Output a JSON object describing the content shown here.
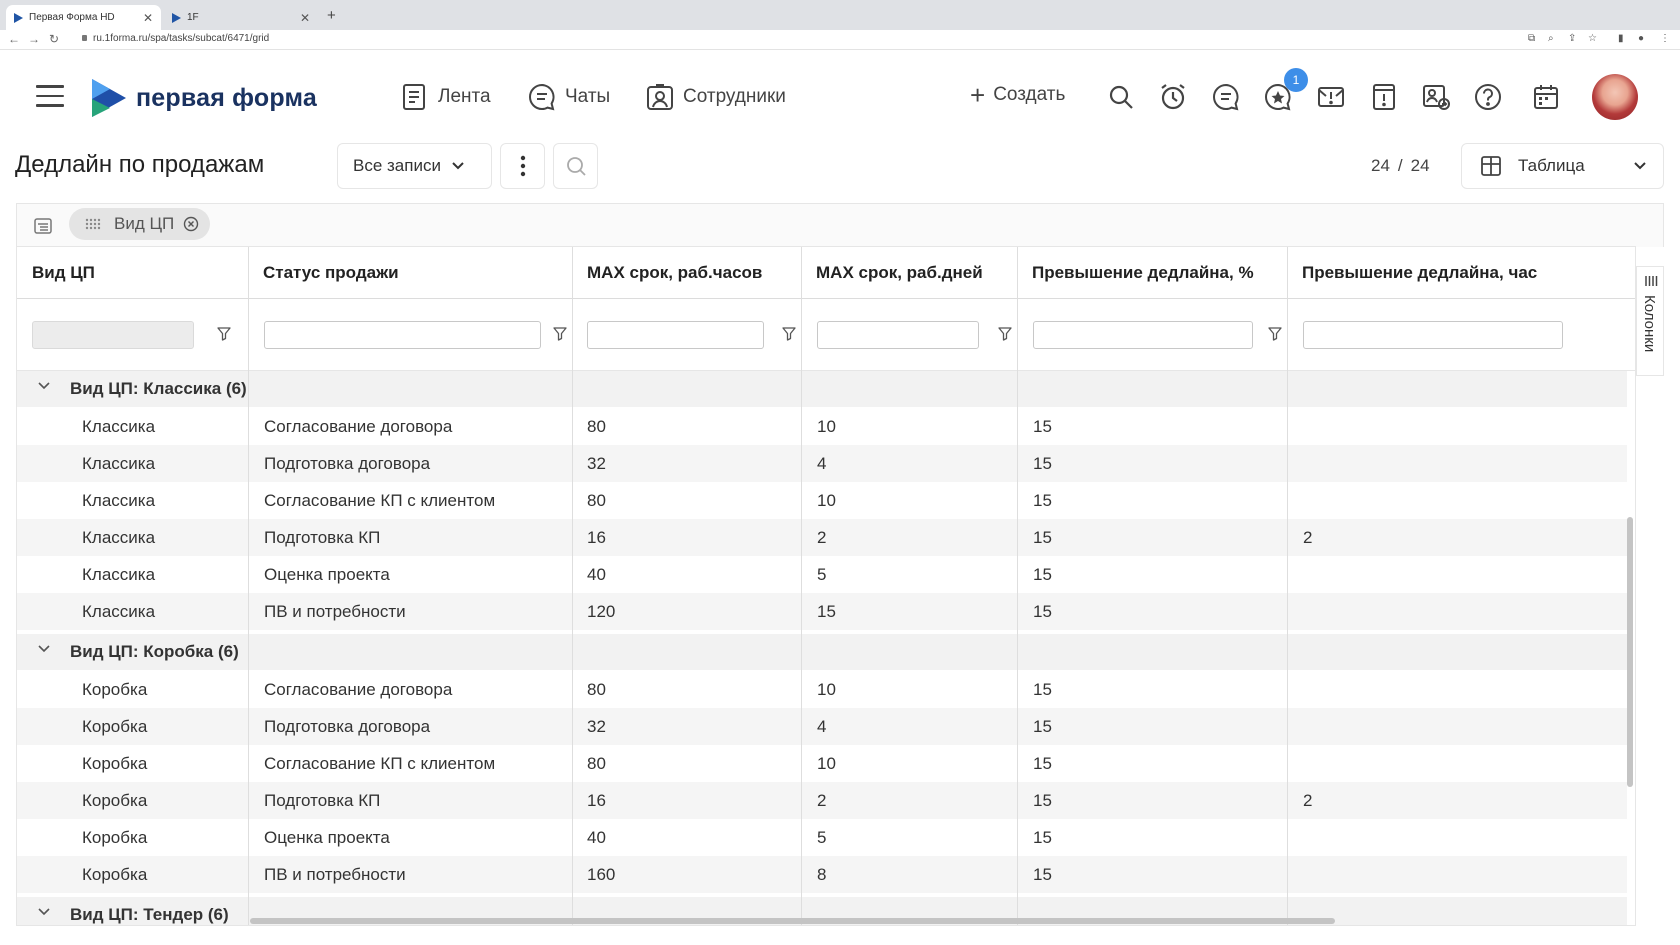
{
  "browser": {
    "tabs": [
      {
        "title": "Первая Форма HD",
        "active": true
      },
      {
        "title": "1F",
        "active": false
      }
    ],
    "new_tab": "+",
    "url": "ru.1forma.ru/spa/tasks/subcat/6471/grid"
  },
  "header": {
    "logo_text": "первая форма",
    "nav": [
      {
        "label": "Лента",
        "icon": "feed-icon"
      },
      {
        "label": "Чаты",
        "icon": "chat-icon"
      },
      {
        "label": "Сотрудники",
        "icon": "employees-icon"
      }
    ],
    "create_label": "Создать",
    "notification_count": "1"
  },
  "toolbar": {
    "title": "Дедлайн по продажам",
    "filter_select": "Все записи",
    "count_shown": "24",
    "count_sep": "/",
    "count_total": "24",
    "view_select": "Таблица"
  },
  "grouping": {
    "chip_label": "Вид ЦП"
  },
  "side_panel": {
    "label": "Колонки"
  },
  "grid": {
    "columns": [
      "Вид ЦП",
      "Статус продажи",
      "MAX срок, раб.часов",
      "MAX срок, раб.дней",
      "Превышение дедлайна, %",
      "Превышение дедлайна, час"
    ],
    "groups": [
      {
        "label": "Вид ЦП: Классика (6)",
        "rows": [
          [
            "Классика",
            "Согласование договора",
            "80",
            "10",
            "15",
            ""
          ],
          [
            "Классика",
            "Подготовка договора",
            "32",
            "4",
            "15",
            ""
          ],
          [
            "Классика",
            "Согласование КП с клиентом",
            "80",
            "10",
            "15",
            ""
          ],
          [
            "Классика",
            "Подготовка КП",
            "16",
            "2",
            "15",
            "2"
          ],
          [
            "Классика",
            "Оценка проекта",
            "40",
            "5",
            "15",
            ""
          ],
          [
            "Классика",
            "ПВ и потребности",
            "120",
            "15",
            "15",
            ""
          ]
        ]
      },
      {
        "label": "Вид ЦП: Коробка (6)",
        "rows": [
          [
            "Коробка",
            "Согласование договора",
            "80",
            "10",
            "15",
            ""
          ],
          [
            "Коробка",
            "Подготовка договора",
            "32",
            "4",
            "15",
            ""
          ],
          [
            "Коробка",
            "Согласование КП с клиентом",
            "80",
            "10",
            "15",
            ""
          ],
          [
            "Коробка",
            "Подготовка КП",
            "16",
            "2",
            "15",
            "2"
          ],
          [
            "Коробка",
            "Оценка проекта",
            "40",
            "5",
            "15",
            ""
          ],
          [
            "Коробка",
            "ПВ и потребности",
            "160",
            "8",
            "15",
            ""
          ]
        ]
      },
      {
        "label": "Вид ЦП: Тендер (6)",
        "rows": []
      }
    ]
  }
}
